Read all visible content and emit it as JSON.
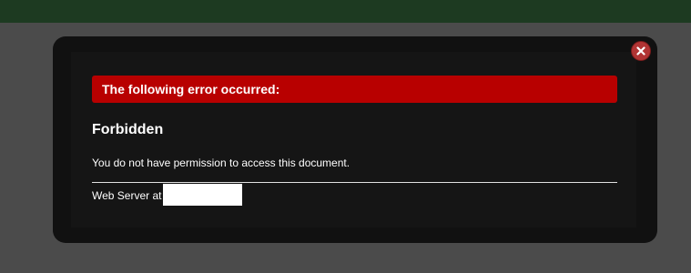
{
  "dialog": {
    "error_heading": "The following error occurred:",
    "title": "Forbidden",
    "message": "You do not have permission to access this document.",
    "server_label": "Web Server at",
    "close_icon": "close-icon"
  },
  "colors": {
    "top_bar": "#1d3a21",
    "overlay": "#4b4b4b",
    "modal_background": "#111111",
    "error_banner": "#b80000",
    "close_button": "#b13434",
    "text": "#ffffff"
  }
}
